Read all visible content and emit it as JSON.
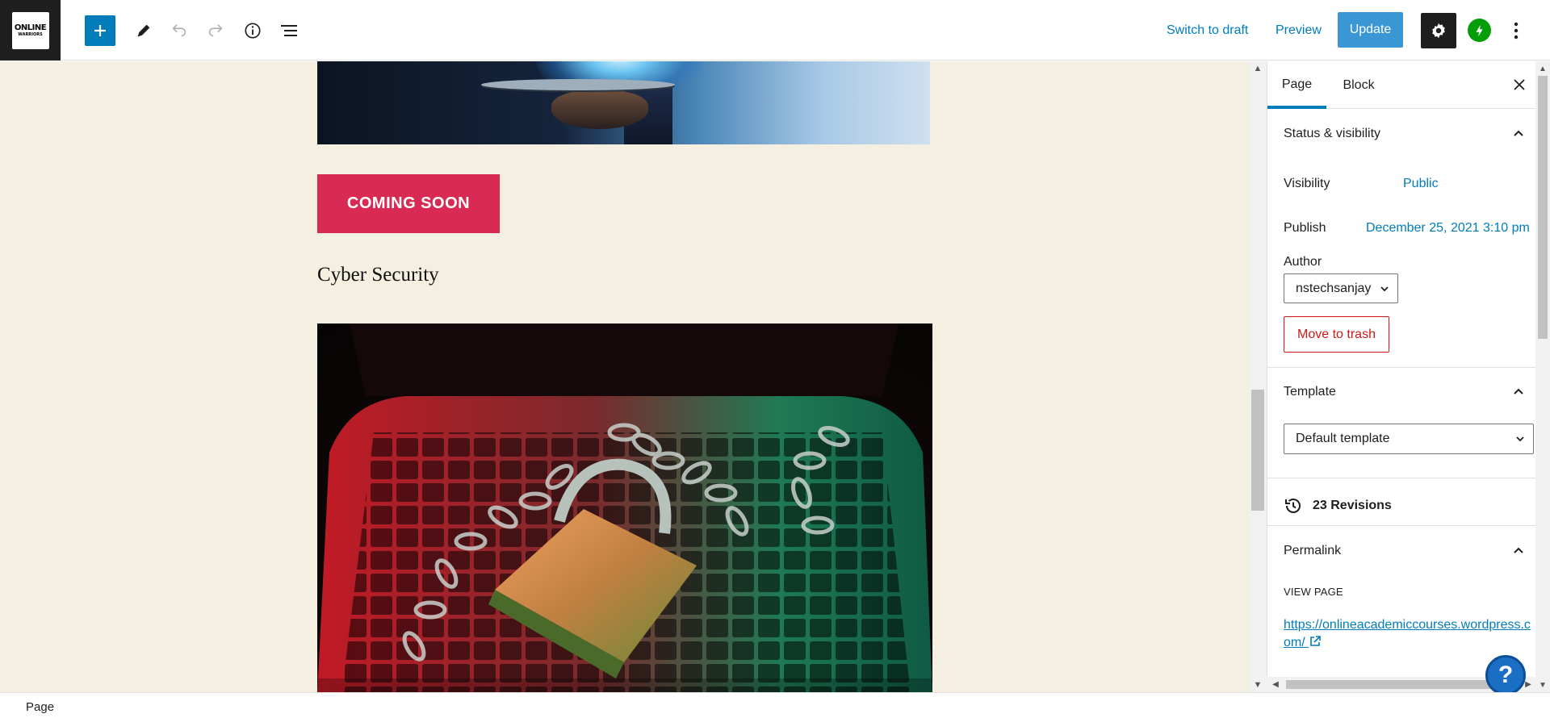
{
  "site": {
    "logo_line1": "ONLINE",
    "logo_line2": "WARRIORS"
  },
  "toolbar": {
    "switch_to_draft_label": "Switch to draft",
    "preview_label": "Preview",
    "update_label": "Update",
    "icons": [
      "plus-icon",
      "pencil-icon",
      "undo-icon",
      "redo-icon",
      "info-icon",
      "list-view-icon",
      "gear-icon",
      "jetpack-icon",
      "more-vertical-icon"
    ],
    "accent_color": "#007cba"
  },
  "content": {
    "button_label": "COMING SOON",
    "heading": "Cyber Security",
    "button_color": "#d82a52",
    "canvas_background": "#f4efe0"
  },
  "sidebar": {
    "tabs": [
      {
        "label": "Page",
        "active": true
      },
      {
        "label": "Block",
        "active": false
      }
    ],
    "status_visibility": {
      "title": "Status & visibility",
      "visibility_label": "Visibility",
      "visibility_value": "Public",
      "publish_label": "Publish",
      "publish_value": "December 25, 2021 3:10 pm",
      "author_label": "Author",
      "author_value": "nstechsanjay",
      "trash_label": "Move to trash"
    },
    "template": {
      "title": "Template",
      "selected": "Default template"
    },
    "revisions_label": "23 Revisions",
    "permalink": {
      "title": "Permalink",
      "view_page_label": "VIEW PAGE",
      "url": "https://onlineacademiccourses.wordpress.com/"
    }
  },
  "help_label": "?",
  "footer": {
    "breadcrumb": "Page"
  }
}
